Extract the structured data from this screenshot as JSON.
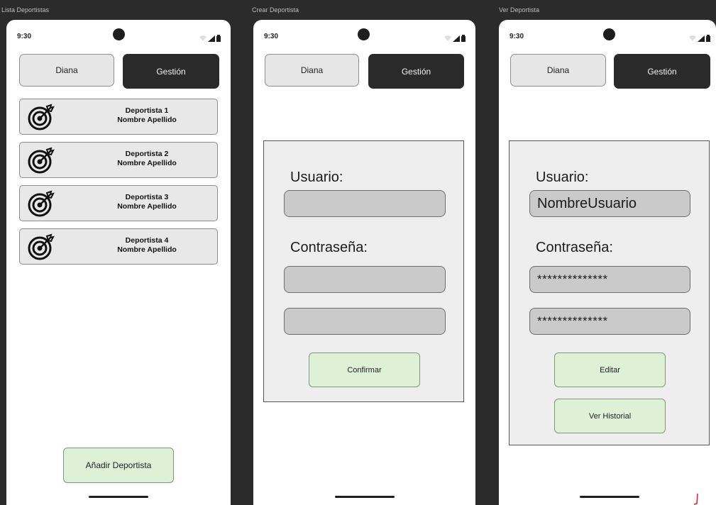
{
  "frames": [
    {
      "label": "Lista Deportistas"
    },
    {
      "label": "Crear Deportista"
    },
    {
      "label": "Ver Deportista"
    }
  ],
  "status": {
    "time": "9:30"
  },
  "tabs": {
    "left": "Diana",
    "right": "Gestión"
  },
  "list": {
    "items": [
      {
        "line1": "Deportista 1",
        "line2": "Nombre Apellido"
      },
      {
        "line1": "Deportista 2",
        "line2": "Nombre Apellido"
      },
      {
        "line1": "Deportista 3",
        "line2": "Nombre Apellido"
      },
      {
        "line1": "Deportista 4",
        "line2": "Nombre Apellido"
      }
    ],
    "add_button": "Añadir Deportista"
  },
  "create": {
    "user_label": "Usuario:",
    "password_label": "Contraseña:",
    "user_value": "",
    "password_value": "",
    "password_confirm_value": "",
    "confirm_button": "Confirmar"
  },
  "view": {
    "user_label": "Usuario:",
    "password_label": "Contraseña:",
    "user_value": "NombreUsuario",
    "password_value": "**************",
    "password_confirm_value": "**************",
    "edit_button": "Editar",
    "history_button": "Ver Historial"
  },
  "icons": {
    "card_icon": "target-icon",
    "wifi": "wifi-icon",
    "signal": "signal-icon",
    "battery": "battery-icon"
  },
  "colors": {
    "dark_tab": "#2a2a2a",
    "green_button": "#def1d6",
    "field_bg": "#cacaca"
  }
}
